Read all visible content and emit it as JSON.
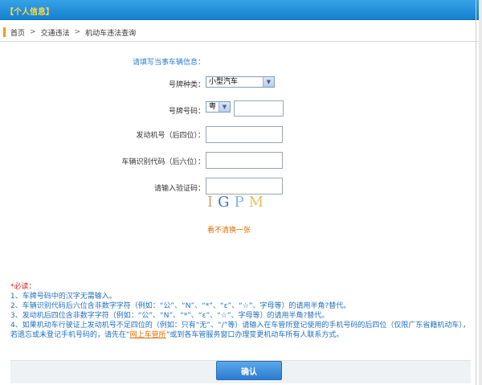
{
  "header": {
    "title": "【个人信息】"
  },
  "breadcrumb": {
    "items": [
      "首页",
      "交通违法",
      "机动车违法查询"
    ],
    "separator": ">"
  },
  "form": {
    "hint": "请填写当事车辆信息：",
    "plate_type": {
      "label": "号牌种类：",
      "value": "小型汽车"
    },
    "plate_number": {
      "label": "号牌号码：",
      "province": "粤",
      "value": ""
    },
    "engine": {
      "label": "发动机号（后四位）：",
      "value": ""
    },
    "vin": {
      "label": "车辆识别代码（后六位）：",
      "value": ""
    },
    "captcha": {
      "label": "请输入验证码：",
      "value": "",
      "text": "IGPM",
      "refresh": "看不清换一张"
    }
  },
  "notes": {
    "title": "*必读：",
    "lines": [
      "1、车牌号码中的汉字无需输入。",
      "2、车辆识别代码后六位含非数字字符（例如：“公”、“N”、“*”、“ε”、“☆”、字母等）的请用半角?替代。",
      "3、发动机后四位含非数字字符（例如：“公”、“N”、“*”、“ε”、“☆”、字母等）的请用半角?替代。",
      "4、如果机动车行驶证上发动机号不足四位的（例如：只有“无”、“/”等）请输入在车管所登记使用的手机号码的后四位（仅限广东省籍机动车），若遗忘或未登记手机号码的，请先在“"
    ],
    "link_text": "网上车管所",
    "tail": "”或到各车管服务窗口办理变更机动车所有人联系方式。"
  },
  "buttons": {
    "confirm": "确认"
  },
  "colors": {
    "header": "#1f8bd8",
    "title": "#ffd84a",
    "hint": "#2a7fcf",
    "notes": "#1f6fc0",
    "warning": "#e02020",
    "link": "#e56b00"
  }
}
